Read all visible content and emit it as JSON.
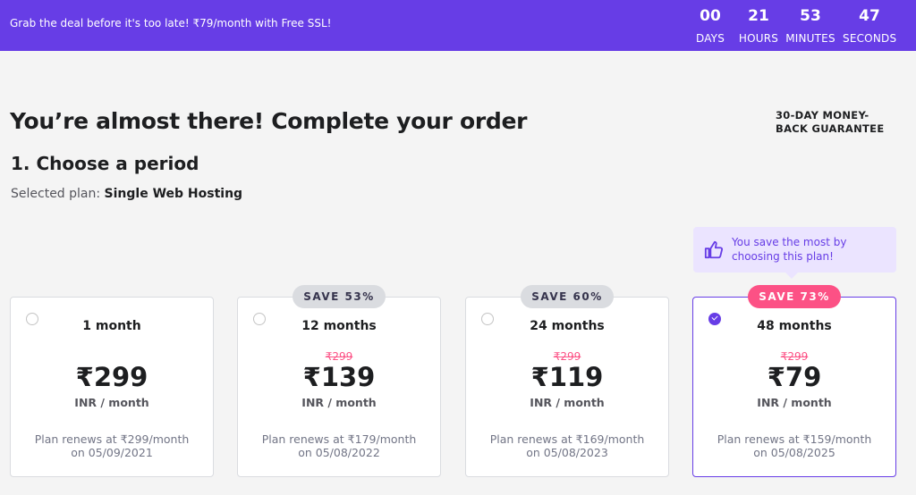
{
  "banner": {
    "text": "Grab the deal before it's too late! ₹79/month with Free SSL!",
    "countdown": [
      {
        "value": "00",
        "label": "DAYS"
      },
      {
        "value": "21",
        "label": "HOURS"
      },
      {
        "value": "53",
        "label": "MINUTES"
      },
      {
        "value": "47",
        "label": "SECONDS"
      }
    ]
  },
  "page": {
    "title": "You’re almost there! Complete your order",
    "guarantee": "30-DAY MONEY-BACK GUARANTEE",
    "step_title": "1. Choose a period",
    "selected_label": "Selected plan:",
    "selected_plan": "Single Web Hosting"
  },
  "tip": {
    "text": "You save the most by choosing this plan!",
    "icon": "thumbs-up-icon"
  },
  "plans": [
    {
      "period": "1 month",
      "old_price": "",
      "price": "₹299",
      "unit": "INR / month",
      "renew_line1": "Plan renews at ₹299/month",
      "renew_line2": "on 05/09/2021",
      "badge": "",
      "selected": false
    },
    {
      "period": "12 months",
      "old_price": "₹299",
      "price": "₹139",
      "unit": "INR / month",
      "renew_line1": "Plan renews at ₹179/month",
      "renew_line2": "on 05/08/2022",
      "badge": "SAVE 53%",
      "selected": false
    },
    {
      "period": "24 months",
      "old_price": "₹299",
      "price": "₹119",
      "unit": "INR / month",
      "renew_line1": "Plan renews at ₹169/month",
      "renew_line2": "on 05/08/2023",
      "badge": "SAVE 60%",
      "selected": false
    },
    {
      "period": "48 months",
      "old_price": "₹299",
      "price": "₹79",
      "unit": "INR / month",
      "renew_line1": "Plan renews at ₹159/month",
      "renew_line2": "on 05/08/2025",
      "badge": "SAVE 73%",
      "selected": true
    }
  ],
  "colors": {
    "brand": "#673de6",
    "badge_hot": "#fc5185",
    "badge_default": "#dadce0",
    "tip_background": "#ebe4ff"
  }
}
